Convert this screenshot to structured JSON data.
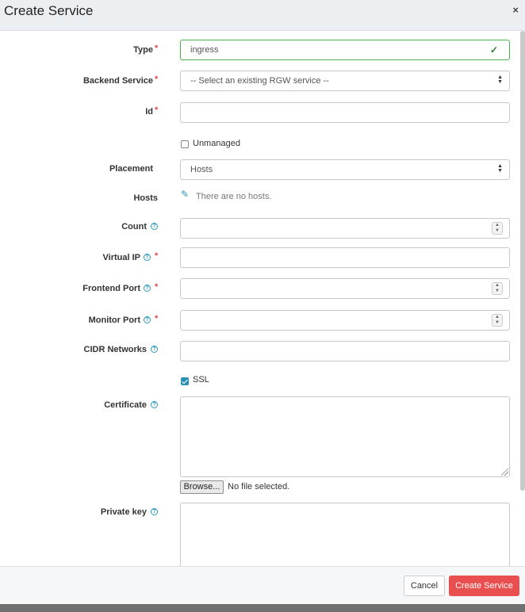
{
  "modal": {
    "title": "Create Service",
    "close_glyph": "×"
  },
  "form": {
    "type": {
      "label": "Type",
      "value": "ingress"
    },
    "backend_service": {
      "label": "Backend Service",
      "value": "-- Select an existing RGW service --"
    },
    "id": {
      "label": "Id",
      "value": ""
    },
    "unmanaged": {
      "label": "Unmanaged",
      "checked": false
    },
    "placement": {
      "label": "Placement",
      "value": "Hosts"
    },
    "hosts": {
      "label": "Hosts",
      "empty_text": "There are no hosts."
    },
    "count": {
      "label": "Count",
      "value": ""
    },
    "virtual_ip": {
      "label": "Virtual IP",
      "value": ""
    },
    "frontend_port": {
      "label": "Frontend Port",
      "value": ""
    },
    "monitor_port": {
      "label": "Monitor Port",
      "value": ""
    },
    "cidr_networks": {
      "label": "CIDR Networks",
      "value": ""
    },
    "ssl": {
      "label": "SSL",
      "checked": true
    },
    "certificate": {
      "label": "Certificate",
      "value": "",
      "browse_label": "Browse...",
      "file_status": "No file selected."
    },
    "private_key": {
      "label": "Private key",
      "value": ""
    }
  },
  "footer": {
    "cancel_label": "Cancel",
    "submit_label": "Create Service"
  },
  "icons": {
    "help": "help-circle-icon",
    "required": "asterisk",
    "valid": "check-icon",
    "edit": "pencil-icon"
  },
  "colors": {
    "accent": "#2b8fb0",
    "danger": "#ea4f4f",
    "valid": "#4caf50",
    "required": "#e0484e"
  }
}
